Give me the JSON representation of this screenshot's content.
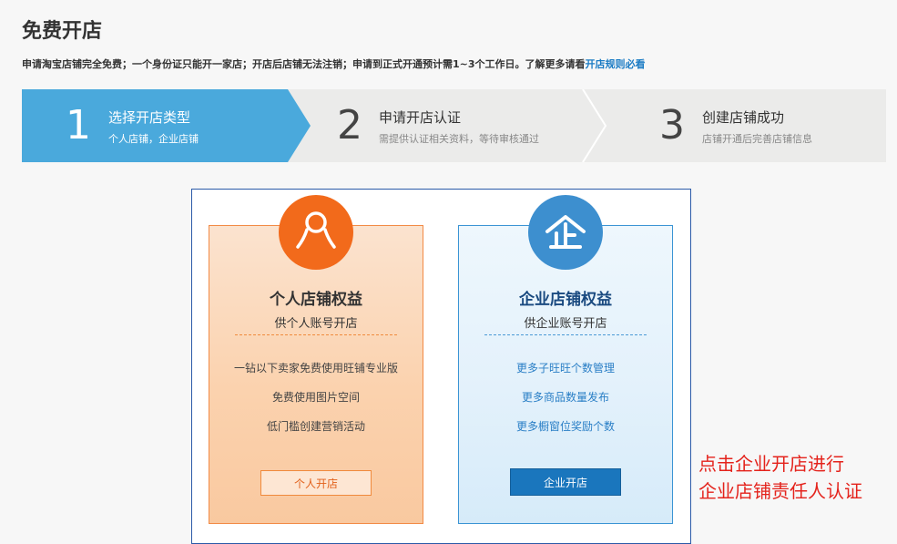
{
  "page": {
    "title": "免费开店",
    "notice": "申请淘宝店铺完全免费；一个身份证只能开一家店；开店后店铺无法注销；申请到正式开通预计需1~3个工作日。了解更多请看",
    "rules_link": "开店规则必看"
  },
  "steps": [
    {
      "number": "1",
      "title": "选择开店类型",
      "desc": "个人店铺，企业店铺",
      "active": true
    },
    {
      "number": "2",
      "title": "申请开店认证",
      "desc": "需提供认证相关资料，等待审核通过",
      "active": false
    },
    {
      "number": "3",
      "title": "创建店铺成功",
      "desc": "店铺开通后完善店铺信息",
      "active": false
    }
  ],
  "cards": {
    "personal": {
      "icon": "person-icon",
      "title": "个人店铺权益",
      "subtitle": "供个人账号开店",
      "features": [
        "一钻以下卖家免费使用旺铺专业版",
        "免费使用图片空间",
        "低门槛创建营销活动"
      ],
      "button": "个人开店"
    },
    "enterprise": {
      "icon": "enterprise-icon",
      "title": "企业店铺权益",
      "subtitle": "供企业账号开店",
      "features": [
        "更多子旺旺个数管理",
        "更多商品数量发布",
        "更多橱窗位奖励个数"
      ],
      "button": "企业开店"
    }
  },
  "annotation": {
    "line1": "点击企业开店进行",
    "line2": "企业店铺责任人认证"
  },
  "colors": {
    "active_step": "#4aa9dc",
    "personal_accent": "#f26a1b",
    "enterprise_accent": "#3d8fcf",
    "enterprise_button": "#1a76bd",
    "annotation": "#e4231c",
    "link": "#1a7bc4"
  }
}
